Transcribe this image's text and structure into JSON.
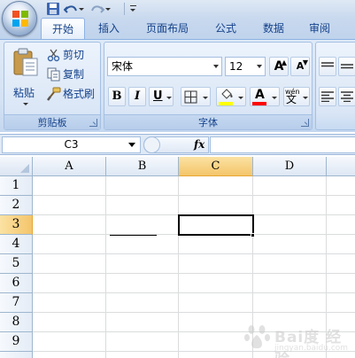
{
  "tabs": [
    "开始",
    "插入",
    "页面布局",
    "公式",
    "数据",
    "审阅"
  ],
  "active_tab": 0,
  "clipboard": {
    "paste_label": "粘贴",
    "cut_label": "剪切",
    "copy_label": "复制",
    "format_painter_label": "格式刷",
    "group_label": "剪贴板"
  },
  "font": {
    "font_name": "宋体",
    "font_size": "12",
    "bold": "B",
    "italic": "I",
    "underline": "U",
    "grow": "A",
    "shrink": "A",
    "font_color_glyph": "A",
    "phonetic_glyph": "wén",
    "group_label": "字体"
  },
  "formula_bar": {
    "name_box": "C3",
    "fx": "fx",
    "formula": ""
  },
  "grid": {
    "columns": [
      "A",
      "B",
      "C",
      "D"
    ],
    "rows": [
      "1",
      "2",
      "3",
      "4",
      "5",
      "6",
      "7",
      "8",
      "9"
    ],
    "active_cell": "C3",
    "selected_column": "C",
    "selected_row": "3"
  },
  "watermark": {
    "line1": "Bai度 经验",
    "line2": "jingyan.baidu.com"
  },
  "colors": {
    "accent": "#15428b",
    "highlight": "#ffff00",
    "font_color": "#ff0000",
    "selection": "#f4c56a"
  }
}
